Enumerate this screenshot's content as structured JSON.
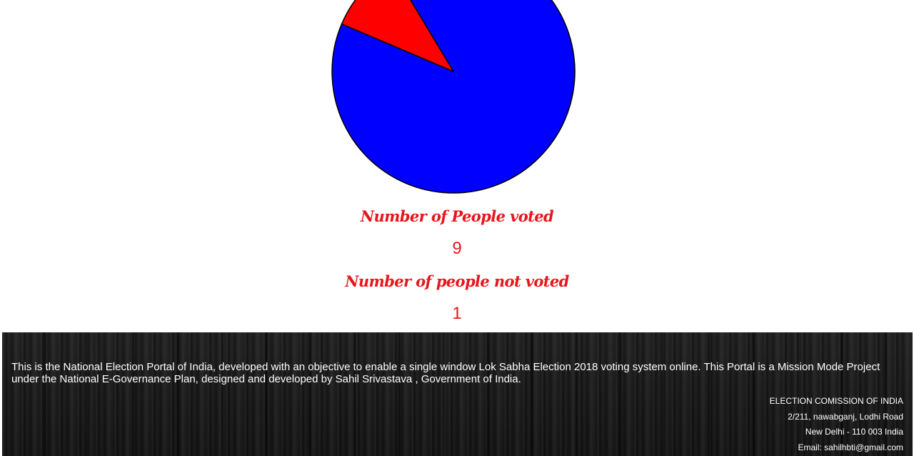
{
  "chart_data": {
    "type": "pie",
    "values": [
      9,
      1
    ],
    "colors": [
      "#0000ff",
      "#ff0000"
    ],
    "stroke": "#000000"
  },
  "stats": {
    "voted_label": "Number of People voted",
    "voted_value": "9",
    "not_voted_label": "Number of people not voted",
    "not_voted_value": "1"
  },
  "footer": {
    "description": "This is the National Election Portal of India, developed with an objective to enable a single window Lok Sabha Election 2018 voting system online. This Portal is a Mission Mode Project under the National E-Governance Plan, designed and developed by Sahil Srivastava , Government of India.",
    "org_name": "ELECTION COMISSION OF INDIA",
    "address_line1": "2/211, nawabganj, Lodhi Road",
    "address_line2": "New Delhi - 110 003 India",
    "email": "Email: sahilhbti@gmail.com"
  }
}
